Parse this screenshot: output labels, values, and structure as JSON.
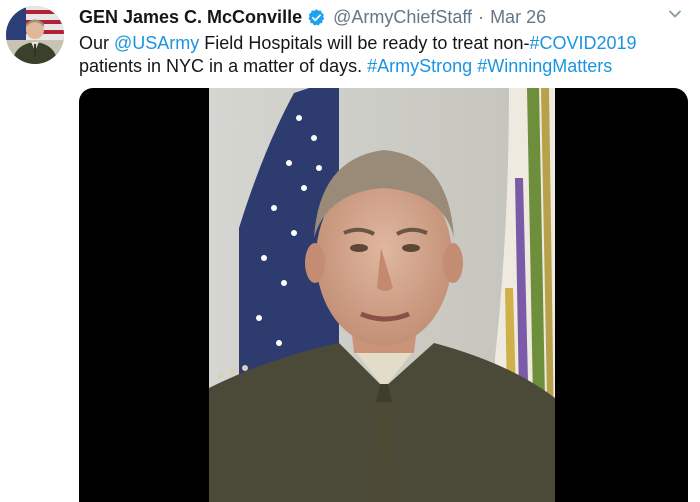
{
  "tweet": {
    "author_name": "GEN James C. McConville",
    "handle": "@ArmyChiefStaff",
    "separator": "·",
    "date": "Mar 26",
    "text": {
      "t1": "Our ",
      "mention": "@USArmy",
      "t2": " Field Hospitals will be ready to treat non-",
      "hashtag1": "#COVID2019",
      "t3": " patients in NYC in a matter of days. ",
      "hashtag2": "#ArmyStrong",
      "t4": " ",
      "hashtag3": "#WinningMatters"
    }
  },
  "icons": {
    "verified": "verified-badge-icon",
    "menu": "chevron-down-icon"
  },
  "colors": {
    "link": "#1b95e0",
    "secondary_text": "#657786",
    "verified_badge": "#1da1f2"
  }
}
